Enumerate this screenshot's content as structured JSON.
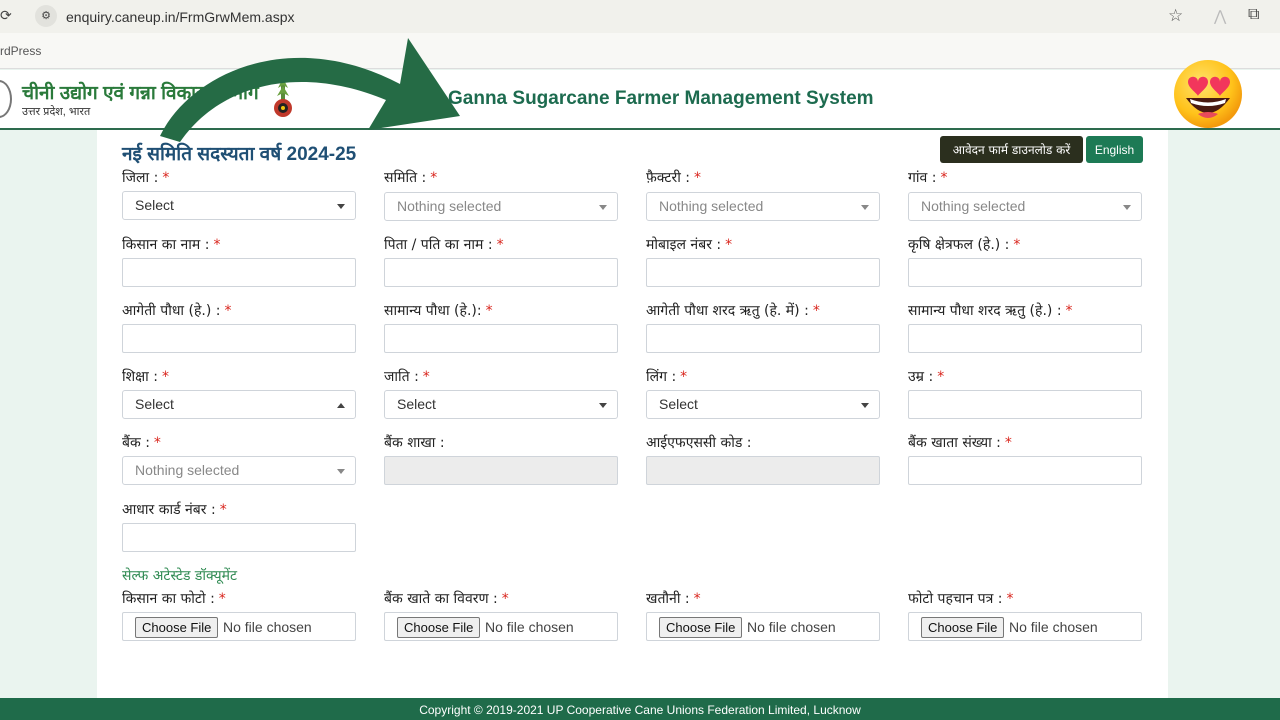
{
  "browser": {
    "url": "enquiry.caneup.in/FrmGrwMem.aspx",
    "bookmark": "rdPress",
    "icons": [
      "reload-icon",
      "site-info-icon",
      "star-icon",
      "extension-icon",
      "puzzle-icon"
    ]
  },
  "header": {
    "dept_title": "चीनी उद्योग एवं गन्ना विकास विभाग",
    "dept_subtitle": "उत्तर प्रदेश, भारत",
    "site_title": "Ganna Sugarcane Farmer Management System"
  },
  "form": {
    "title": "नई समिति सदस्यता वर्ष 2024-25",
    "download_button": "आवेदन फार्म डाउनलोड करें",
    "language_button": "English",
    "required_mark": "*",
    "row1": {
      "district_label": "जिला :",
      "district_value": "Select",
      "society_label": "समिति :",
      "society_value": "Nothing selected",
      "factory_label": "फ़ैक्टरी :",
      "factory_value": "Nothing selected",
      "village_label": "गांव :",
      "village_value": "Nothing selected"
    },
    "row2": {
      "farmer_name_label": "किसान का नाम :",
      "father_name_label": "पिता / पति का नाम :",
      "mobile_label": "मोबाइल नंबर :",
      "farm_area_label": "कृषि क्षेत्रफल (हे.) :"
    },
    "row3": {
      "early_plant_label": "आगेती पौधा (हे.) :",
      "normal_plant_label": "सामान्य पौधा (हे.):",
      "early_autumn_label": "आगेती पौधा शरद ऋतु (हे. में) :",
      "normal_autumn_label": "सामान्य पौधा शरद ऋतु (हे.) :"
    },
    "row4": {
      "education_label": "शिक्षा :",
      "education_value": "Select",
      "caste_label": "जाति :",
      "caste_value": "Select",
      "gender_label": "लिंग :",
      "gender_value": "Select",
      "age_label": "उम्र :"
    },
    "row5": {
      "bank_label": "बैंक :",
      "bank_value": "Nothing selected",
      "branch_label": "बैंक शाखा :",
      "ifsc_label": "आईएफएससी कोड :",
      "account_label": "बैंक खाता संख्या :"
    },
    "row6": {
      "aadhaar_label": "आधार कार्ड नंबर :"
    },
    "documents": {
      "section_title": "सेल्फ अटेस्टेड डॉक्यूमेंट",
      "farmer_photo_label": "किसान का फोटो :",
      "bank_details_label": "बैंक खाते का विवरण :",
      "khatauni_label": "खतौनी :",
      "photo_id_label": "फोटो पहचान पत्र :",
      "choose_file": "Choose File",
      "no_file": "No file chosen"
    }
  },
  "footer": {
    "copyright": "Copyright © 2019-2021 UP Cooperative Cane Unions Federation Limited, Lucknow"
  },
  "colors": {
    "brand_green": "#1d6b4f",
    "footer_green": "#1f6b4a",
    "required_red": "#d9241c",
    "title_blue": "#1f4f74",
    "arrow_green": "#256b45"
  }
}
